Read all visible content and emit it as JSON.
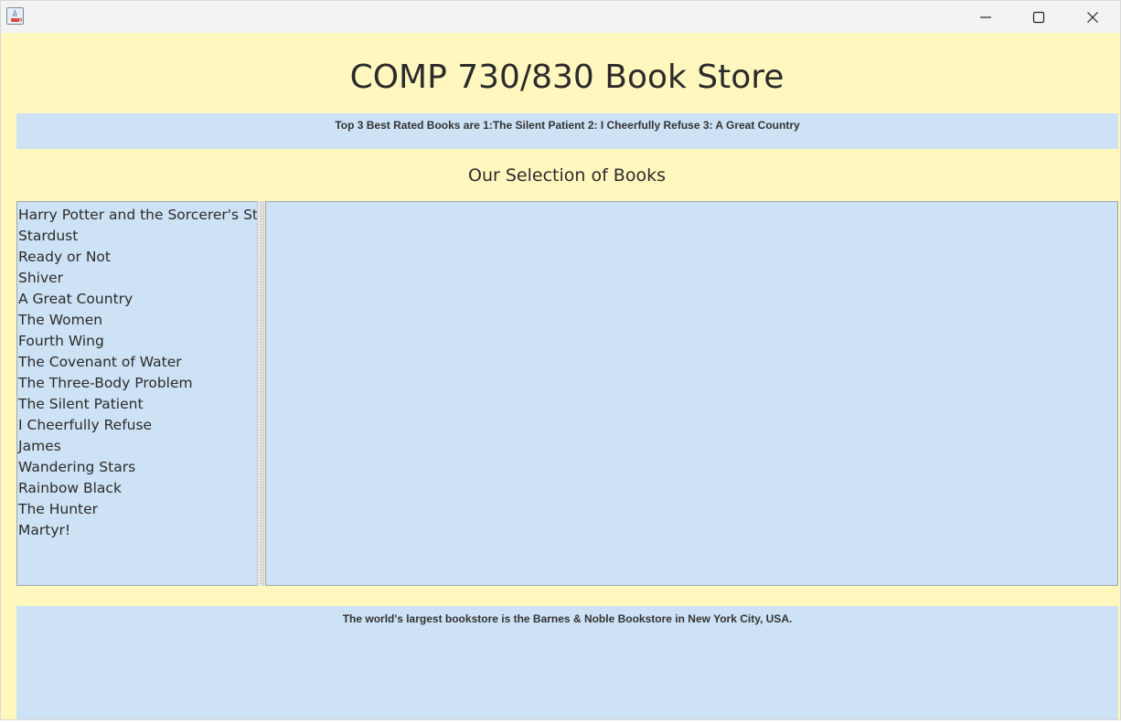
{
  "window": {
    "title": "",
    "controls": {
      "minimize_icon": "minimize-icon",
      "maximize_icon": "maximize-icon",
      "close_icon": "close-icon"
    }
  },
  "header": {
    "title": "COMP 730/830 Book Store"
  },
  "top_banner": {
    "text": "Top 3 Best Rated Books are 1:The Silent Patient 2: I Cheerfully Refuse 3: A Great Country"
  },
  "selection": {
    "heading": "Our Selection of Books",
    "books": [
      "Harry Potter and the Sorcerer's Stone",
      "Stardust",
      "Ready or Not",
      "Shiver",
      "A Great Country",
      "The Women",
      "Fourth Wing",
      "The Covenant of Water",
      "The Three-Body Problem",
      "The Silent Patient",
      "I Cheerfully Refuse",
      "James",
      "Wandering Stars",
      "Rainbow Black",
      "The Hunter",
      "Martyr!"
    ]
  },
  "bottom_banner": {
    "text": "The world's largest bookstore is the Barnes & Noble Bookstore in New York City, USA."
  },
  "colors": {
    "window_background": "#fff7bd",
    "panel_background": "#cde2f4",
    "titlebar_background": "#f3f3f3",
    "text": "#2b2b2b"
  }
}
